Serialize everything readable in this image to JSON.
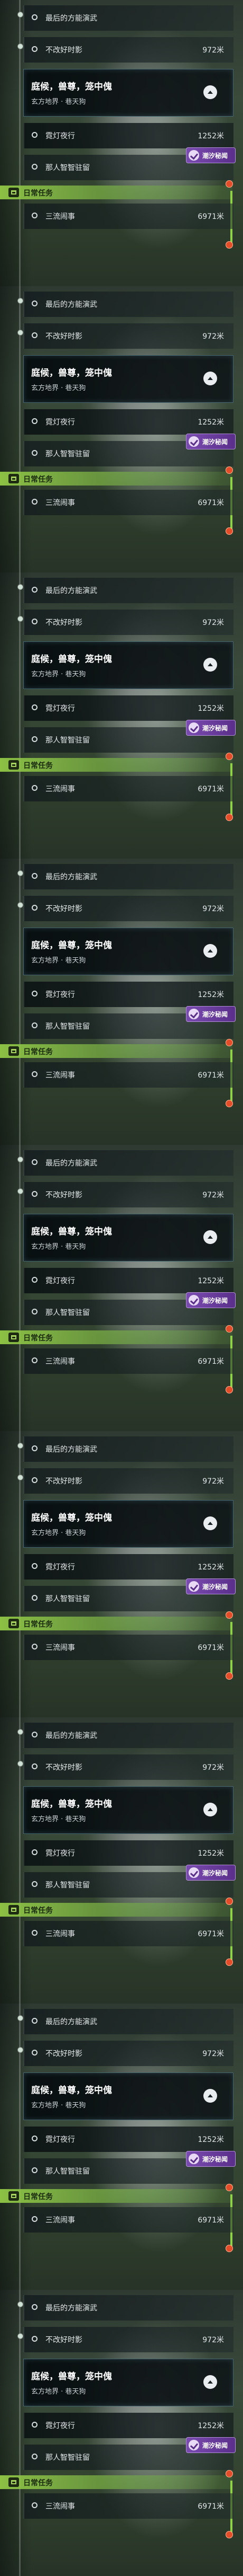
{
  "blocks": [
    {
      "rows": [
        {
          "label": "最后的方能演武",
          "dist": ""
        },
        {
          "label": "不改好时影",
          "dist": "972米"
        }
      ],
      "main_quest": {
        "title": "庭候，兽尊，笼中傀",
        "subtitle": "玄方地界 · 巷天狗"
      },
      "sub_rows": [
        {
          "label": "霓灯夜行",
          "dist": "1252米"
        },
        {
          "label": "那人智智驻留",
          "dist": ""
        }
      ],
      "daily": {
        "header": "日常任务",
        "items": [
          {
            "label": "三流闹事",
            "dist": "6971米"
          }
        ]
      },
      "promo": {
        "text": "潮汐秘闻"
      }
    }
  ],
  "colors": {
    "accent_green": "#8fd24a",
    "promo_purple": "#6a3ea0",
    "warning": "#e34d2a"
  },
  "icons": {
    "row_marker": "circle-outline-icon",
    "collapse": "chevron-up-icon",
    "daily": "task-list-icon",
    "promo": "checkmark-icon",
    "alert": "alert-dot-icon"
  }
}
